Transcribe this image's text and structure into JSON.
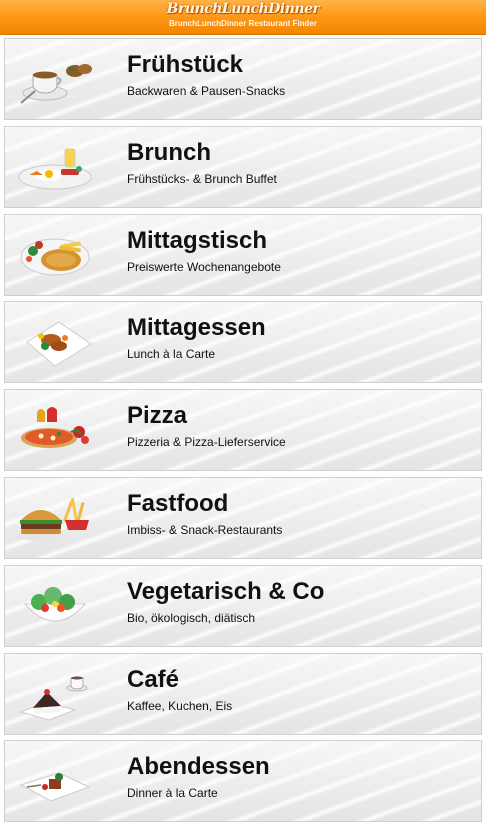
{
  "header": {
    "logo_text": "BrunchLunchDinner",
    "subtitle": "BrunchLunchDinner Restaurant Finder"
  },
  "categories": [
    {
      "title": "Frühstück",
      "description": "Backwaren & Pausen-Snacks",
      "icon": "coffee-icon"
    },
    {
      "title": "Brunch",
      "description": "Frühstücks- & Brunch Buffet",
      "icon": "brunch-plate-icon"
    },
    {
      "title": "Mittagstisch",
      "description": "Preiswerte Wochenangebote",
      "icon": "schnitzel-plate-icon"
    },
    {
      "title": "Mittagessen",
      "description": "Lunch à la Carte",
      "icon": "lunch-plate-icon"
    },
    {
      "title": "Pizza",
      "description": "Pizzeria & Pizza-Lieferservice",
      "icon": "pizza-icon"
    },
    {
      "title": "Fastfood",
      "description": "Imbiss- & Snack-Restaurants",
      "icon": "burger-icon"
    },
    {
      "title": "Vegetarisch & Co",
      "description": "Bio, ökologisch, diätisch",
      "icon": "salad-icon"
    },
    {
      "title": "Café",
      "description": "Kaffee, Kuchen, Eis",
      "icon": "cake-icon"
    },
    {
      "title": "Abendessen",
      "description": "Dinner à la Carte",
      "icon": "dinner-plate-icon"
    }
  ]
}
